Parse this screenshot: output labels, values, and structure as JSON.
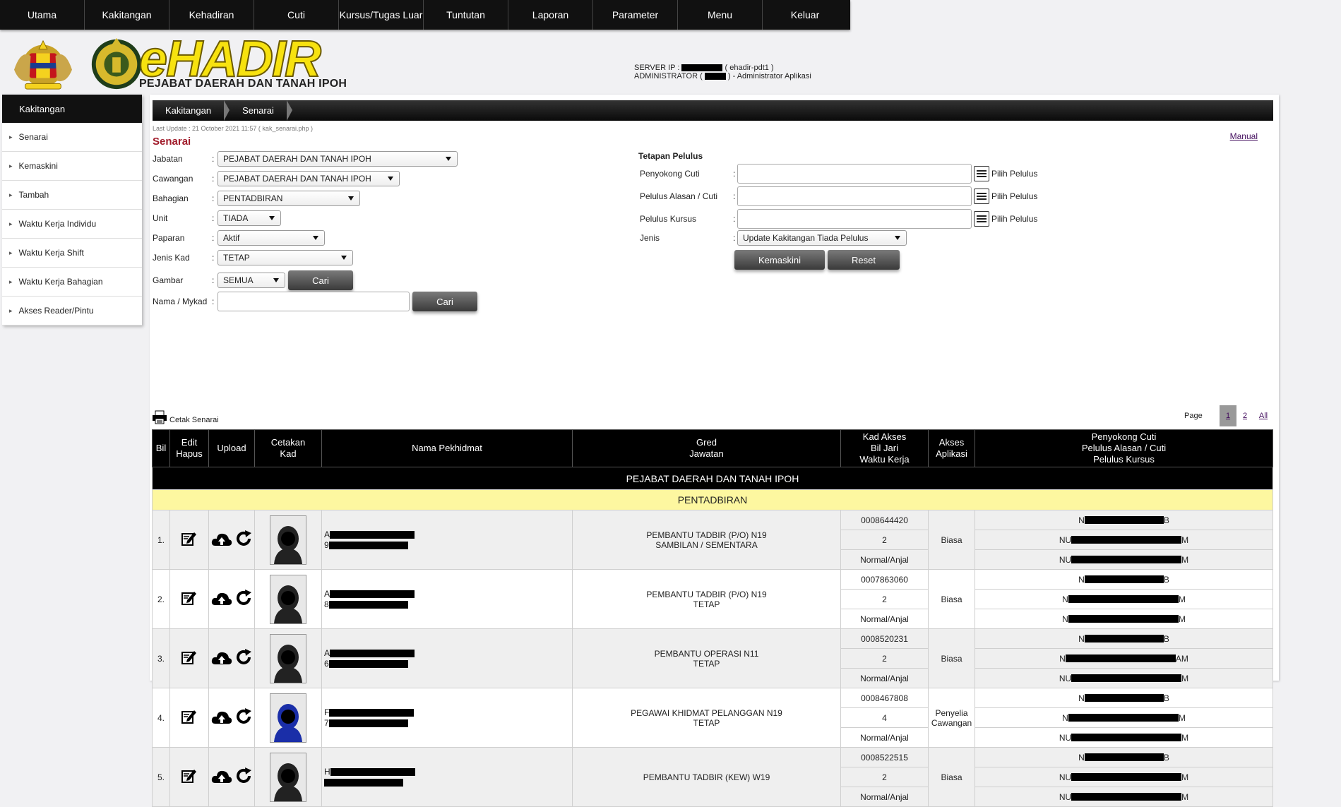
{
  "nav": [
    "Utama",
    "Kakitangan",
    "Kehadiran",
    "Cuti",
    "Kursus/Tugas Luar",
    "Tuntutan",
    "Laporan",
    "Parameter",
    "Menu",
    "Keluar"
  ],
  "header": {
    "app_title": "eHADIR",
    "org_name": "PEJABAT DAERAH DAN TANAH IPOH",
    "server_label": "SERVER IP :",
    "server_name": "( ehadir-pdt1 )",
    "admin_label": "ADMINISTRATOR (",
    "admin_suffix": ") - Administrator Aplikasi"
  },
  "sidebar": {
    "title": "Kakitangan",
    "items": [
      "Senarai",
      "Kemaskini",
      "Tambah",
      "Waktu Kerja Individu",
      "Waktu Kerja Shift",
      "Waktu Kerja Bahagian",
      "Akses Reader/Pintu"
    ]
  },
  "breadcrumb": [
    "Kakitangan",
    "Senarai"
  ],
  "last_update": "Last Update : 21 October 2021 11:57 ( kak_senarai.php )",
  "manual": "Manual",
  "section_title": "Senarai",
  "filters": {
    "jabatan": {
      "label": "Jabatan",
      "value": "PEJABAT DAERAH DAN TANAH IPOH"
    },
    "cawangan": {
      "label": "Cawangan",
      "value": "PEJABAT DAERAH DAN TANAH IPOH"
    },
    "bahagian": {
      "label": "Bahagian",
      "value": "PENTADBIRAN"
    },
    "unit": {
      "label": "Unit",
      "value": "TIADA"
    },
    "paparan": {
      "label": "Paparan",
      "value": "Aktif"
    },
    "jenis_kad": {
      "label": "Jenis Kad",
      "value": "TETAP"
    },
    "gambar": {
      "label": "Gambar",
      "value": "SEMUA"
    },
    "nama": {
      "label": "Nama / Mykad",
      "value": ""
    },
    "cari": "Cari"
  },
  "approver": {
    "title": "Tetapan Pelulus",
    "penyokong": "Penyokong Cuti",
    "pelulus_cuti": "Pelulus Alasan / Cuti",
    "pelulus_kursus": "Pelulus Kursus",
    "pick": "Pilih Pelulus",
    "jenis_label": "Jenis",
    "jenis_value": "Update Kakitangan Tiada Pelulus",
    "kemaskini": "Kemaskini",
    "reset": "Reset"
  },
  "cetak": "Cetak Senarai",
  "pager": {
    "label": "Page",
    "pages": [
      "1",
      "2",
      "All"
    ]
  },
  "table": {
    "headers": {
      "bil": "Bil",
      "edit1": "Edit",
      "edit2": "Hapus",
      "upload": "Upload",
      "cetak1": "Cetakan",
      "cetak2": "Kad",
      "nama": "Nama Pekhidmat",
      "gred1": "Gred",
      "gred2": "Jawatan",
      "kad1": "Kad Akses",
      "kad2": "Bil Jari",
      "kad3": "Waktu Kerja",
      "akses1": "Akses",
      "akses2": "Aplikasi",
      "pel1": "Penyokong Cuti",
      "pel2": "Pelulus Alasan / Cuti",
      "pel3": "Pelulus Kursus"
    },
    "office": "PEJABAT DAERAH DAN TANAH IPOH",
    "dept": "PENTADBIRAN",
    "rows": [
      {
        "bil": "1.",
        "n1": "A",
        "n2": "9",
        "g1": "PEMBANTU TADBIR (P/O) N19",
        "g2": "SAMBILAN / SEMENTARA",
        "kad": "0008644420",
        "jari": "2",
        "waktu": "Normal/Anjal",
        "akses1": "Biasa",
        "akses2": "",
        "p1a": "N",
        "p1b": "B",
        "p2a": "NU",
        "p2b": "M",
        "p3a": "NU",
        "p3b": "M"
      },
      {
        "bil": "2.",
        "n1": "A",
        "n2": "8",
        "g1": "PEMBANTU TADBIR (P/O) N19",
        "g2": "TETAP",
        "kad": "0007863060",
        "jari": "2",
        "waktu": "Normal/Anjal",
        "akses1": "Biasa",
        "akses2": "",
        "p1a": "N",
        "p1b": "B",
        "p2a": "N",
        "p2b": "M",
        "p3a": "N",
        "p3b": "M"
      },
      {
        "bil": "3.",
        "n1": "A",
        "n2": "6",
        "g1": "PEMBANTU OPERASI N11",
        "g2": "TETAP",
        "kad": "0008520231",
        "jari": "2",
        "waktu": "Normal/Anjal",
        "akses1": "Biasa",
        "akses2": "",
        "p1a": "N",
        "p1b": "B",
        "p2a": "N",
        "p2b": "AM",
        "p3a": "NU",
        "p3b": "M"
      },
      {
        "bil": "4.",
        "n1": "F",
        "n2": "7",
        "g1": "PEGAWAI KHIDMAT PELANGGAN N19",
        "g2": "TETAP",
        "kad": "0008467808",
        "jari": "4",
        "waktu": "Normal/Anjal",
        "akses1": "Penyelia",
        "akses2": "Cawangan",
        "p1a": "N",
        "p1b": "B",
        "p2a": "N",
        "p2b": "M",
        "p3a": "NU",
        "p3b": "M"
      },
      {
        "bil": "5.",
        "n1": "H",
        "n2": "",
        "g1": "PEMBANTU TADBIR (KEW) W19",
        "g2": "",
        "kad": "0008522515",
        "jari": "2",
        "waktu": "Normal/Anjal",
        "akses1": "Biasa",
        "akses2": "",
        "p1a": "N",
        "p1b": "B",
        "p2a": "NU",
        "p2b": "M",
        "p3a": "NU",
        "p3b": "M"
      }
    ]
  },
  "colors": {
    "accent": "#a11c2b",
    "title_yellow": "#f7e20f",
    "dept_band": "#fdf7a0"
  }
}
